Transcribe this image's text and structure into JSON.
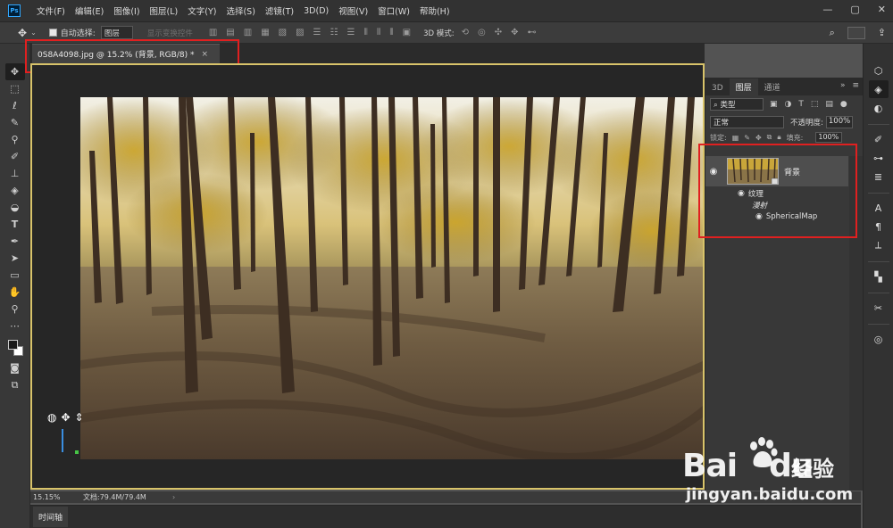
{
  "app": {
    "logo": "Ps"
  },
  "menu": [
    "文件(F)",
    "编辑(E)",
    "图像(I)",
    "图层(L)",
    "文字(Y)",
    "选择(S)",
    "滤镜(T)",
    "3D(D)",
    "视图(V)",
    "窗口(W)",
    "帮助(H)"
  ],
  "window_controls": {
    "minimize": "—",
    "maximize": "▢",
    "close": "✕"
  },
  "options_bar": {
    "auto_select_label": "自动选择:",
    "auto_select_value": "图层",
    "show_transform_label": "显示变换控件",
    "mode_3d_label": "3D 模式:"
  },
  "document": {
    "tab_title": "0S8A4098.jpg @ 15.2% (背景, RGB/8) *",
    "close_glyph": "×"
  },
  "status": {
    "zoom": "15.15%",
    "doc_size": "文档:79.4M/79.4M",
    "arrow": "›"
  },
  "timeline": {
    "label": "时间轴"
  },
  "layers_panel": {
    "tabs": [
      "3D",
      "图层",
      "通道"
    ],
    "active_tab": "图层",
    "filter_label": "类型",
    "blend_mode": "正常",
    "opacity_label": "不透明度:",
    "opacity_value": "100%",
    "lock_label": "锁定:",
    "fill_label": "填充:",
    "fill_value": "100%",
    "layer": {
      "name": "背景",
      "effects": [
        "纹理",
        "漫射",
        "SphericalMap"
      ]
    }
  },
  "watermark": {
    "brand": "Bai",
    "brand_suffix": "du",
    "cn": "经验",
    "domain": "jingyan.baidu.com"
  },
  "colors": {
    "highlight_red": "#e02020",
    "canvas_border": "#d8c36a",
    "foreground": "#1a1a1a",
    "background": "#ffffff"
  },
  "icons": {
    "toolbar": [
      "move-icon",
      "marquee-icon",
      "lasso-icon",
      "quick-select-icon",
      "eyedropper-icon",
      "brush-icon",
      "stamp-icon",
      "eraser-icon",
      "paint-bucket-icon",
      "text-icon",
      "pen-icon",
      "path-select-icon",
      "rectangle-icon",
      "hand-icon",
      "zoom-icon",
      "more-icon"
    ],
    "dock": [
      "3d-icon",
      "layers-icon",
      "adjustments-icon",
      "brush-settings-icon",
      "properties-icon",
      "character-icon",
      "paragraph-icon",
      "actions-icon",
      "tools-icon",
      "3d-material-icon"
    ]
  }
}
